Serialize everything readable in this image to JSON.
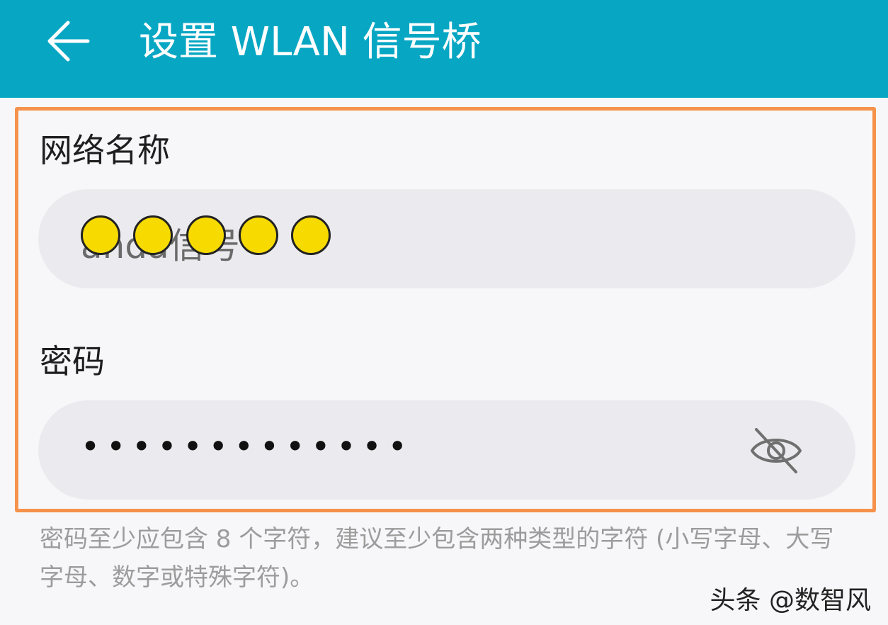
{
  "header": {
    "title": "设置 WLAN 信号桥",
    "background_color": "#07a7c4",
    "back_icon": "arrow-left-icon"
  },
  "highlight_color": "#f5924b",
  "network_name": {
    "label": "网络名称",
    "value": "anda信号"
  },
  "password": {
    "label": "密码",
    "masked_value": "•••••••••••••",
    "visibility_icon": "eye-off-icon"
  },
  "hint": "密码至少应包含 8 个字符，建议至少包含两种类型的字符 (小写字母、大写字母、数字或特殊字符)。",
  "watermark": "头条 @数智风"
}
